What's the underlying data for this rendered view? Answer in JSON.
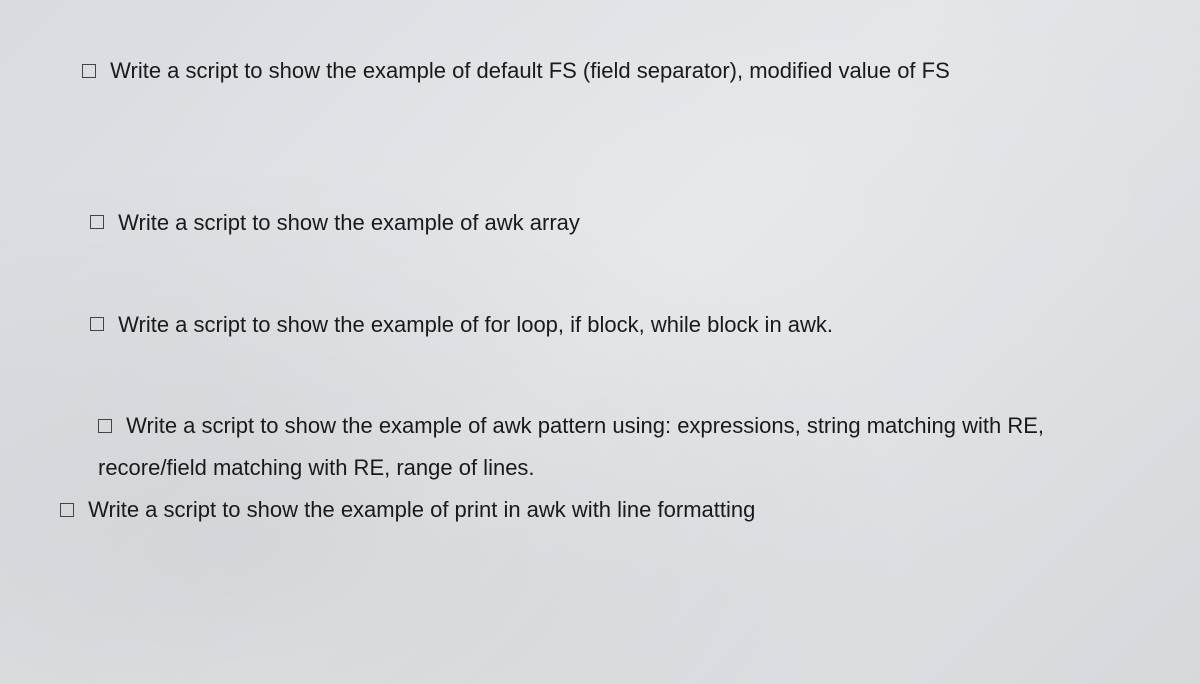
{
  "items": [
    {
      "text": "Write a script to show the example of default FS (field separator), modified value of FS"
    },
    {
      "text": "Write a script to show the example of awk array"
    },
    {
      "text": "Write a script to show the example of for loop, if block, while block in awk."
    },
    {
      "text": "Write a script to show the example of awk pattern using: expressions, string matching with RE,  recore/field matching with RE, range of lines."
    },
    {
      "text": "Write a script to show the example of print in awk with line formatting"
    }
  ]
}
